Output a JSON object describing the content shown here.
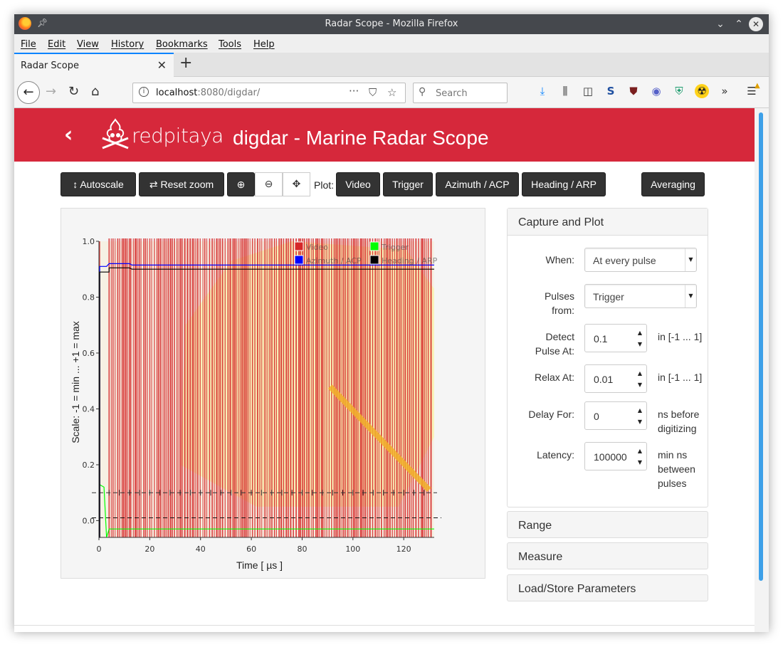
{
  "window": {
    "title": "Radar Scope - Mozilla Firefox"
  },
  "menu": [
    "File",
    "Edit",
    "View",
    "History",
    "Bookmarks",
    "Tools",
    "Help"
  ],
  "tab": {
    "title": "Radar Scope"
  },
  "url": {
    "host": "localhost",
    "rest": ":8080/digdar/"
  },
  "search": {
    "placeholder": "Search"
  },
  "brand": {
    "logo_text": "redpitaya",
    "title": "digdar - Marine Radar Scope"
  },
  "toolbar": {
    "autoscale": "Autoscale",
    "reset_zoom": "Reset zoom",
    "plot_label": "Plot:",
    "video": "Video",
    "trigger": "Trigger",
    "azimuth": "Azimuth / ACP",
    "heading": "Heading / ARP",
    "averaging": "Averaging"
  },
  "panel": {
    "title": "Capture and Plot",
    "when": {
      "label": "When:",
      "value": "At every pulse"
    },
    "pulses_from": {
      "label1": "Pulses",
      "label2": "from:",
      "value": "Trigger"
    },
    "detect": {
      "label1": "Detect",
      "label2": "Pulse At:",
      "value": "0.1",
      "unit": "in [-1 ... 1]"
    },
    "relax": {
      "label": "Relax At:",
      "value": "0.01",
      "unit": "in [-1 ... 1]"
    },
    "delay": {
      "label": "Delay For:",
      "value": "0",
      "unit1": "ns before",
      "unit2": "digitizing"
    },
    "latency": {
      "label": "Latency:",
      "value": "100000",
      "unit1": "min ns",
      "unit2": "between",
      "unit3": "pulses"
    }
  },
  "sections": [
    "Range",
    "Measure",
    "Load/Store Parameters"
  ],
  "chart_data": {
    "type": "line",
    "xlabel": "Time [ µs ]",
    "ylabel": "Scale: -1 = min ... +1 = max",
    "xlim": [
      0,
      132
    ],
    "ylim": [
      -0.06,
      1.0
    ],
    "xticks": [
      0,
      20,
      40,
      60,
      80,
      100,
      120
    ],
    "yticks": [
      0.0,
      0.2,
      0.4,
      0.6,
      0.8,
      1.0
    ],
    "legend_position": "top-right",
    "series": [
      {
        "name": "Video",
        "color": "#d62728",
        "x": [],
        "y": []
      },
      {
        "name": "Trigger",
        "color": "#00ff00",
        "x": [
          0,
          2,
          3,
          4,
          6,
          132
        ],
        "y": [
          0.13,
          0.12,
          -0.06,
          -0.03,
          -0.03,
          -0.03
        ]
      },
      {
        "name": "Azimuth / ACP",
        "color": "#0000ff",
        "x": [
          0,
          0.3,
          0.3,
          3,
          4,
          4,
          12,
          13,
          132
        ],
        "y": [
          -0.06,
          -0.06,
          0.91,
          0.91,
          0.92,
          0.92,
          0.92,
          0.915,
          0.915
        ]
      },
      {
        "name": "Heading / ARP",
        "color": "#000000",
        "x": [
          0,
          0.3,
          0.3,
          4,
          4,
          12,
          13,
          132
        ],
        "y": [
          -0.06,
          -0.06,
          0.89,
          0.89,
          0.905,
          0.905,
          0.9,
          0.9
        ]
      }
    ],
    "threshold_lines": [
      {
        "y": 0.1,
        "style": "dashed-cross"
      },
      {
        "y": 0.01,
        "style": "dashed"
      }
    ]
  }
}
